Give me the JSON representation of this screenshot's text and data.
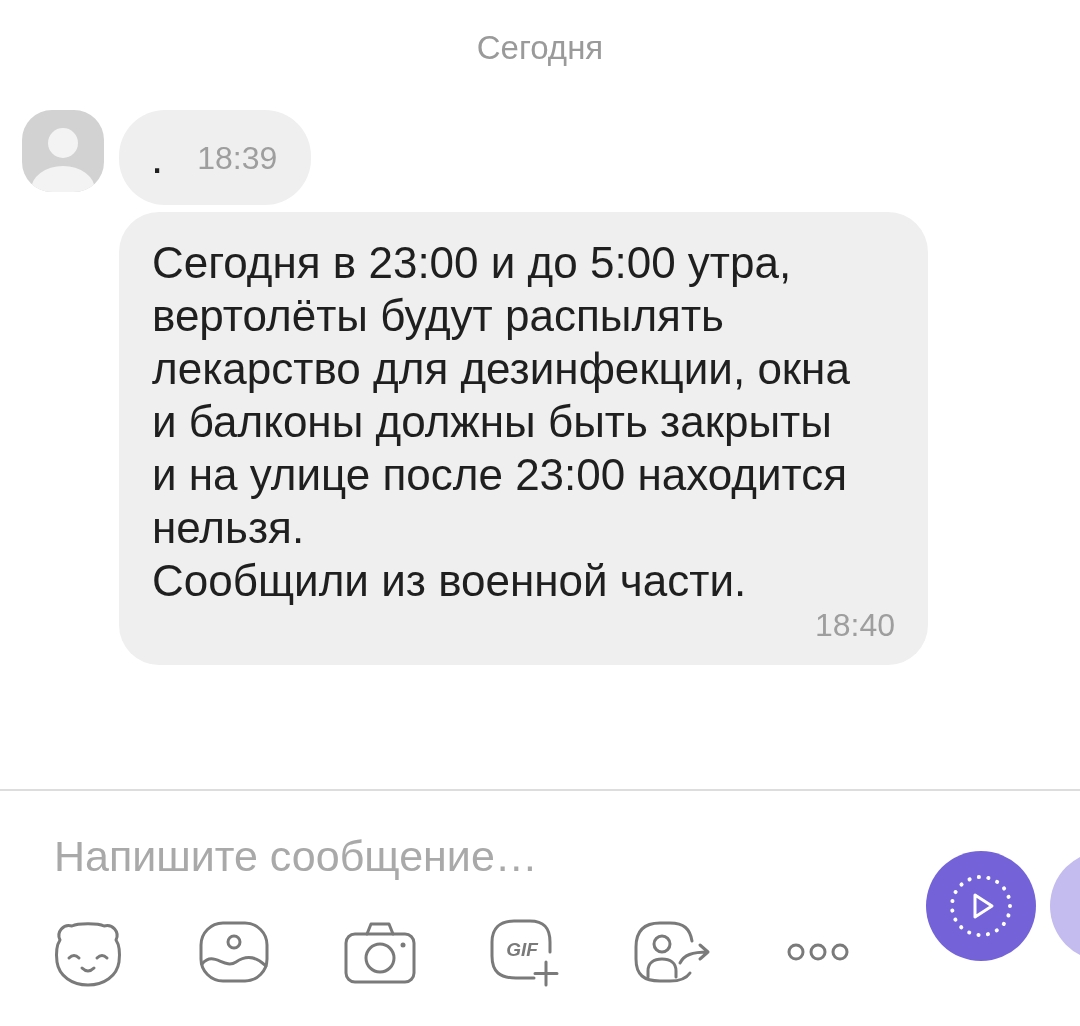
{
  "date_header": "Сегодня",
  "messages": [
    {
      "kind": "first",
      "text": ".",
      "time": "18:39"
    },
    {
      "kind": "continued",
      "text": "Сегодня в 23:00 и до 5:00 утра, вертолёты будут распылять лекарство для дезинфекции, окна и балконы должны быть закрыты и на улице после 23:00 находится нельзя.\nСообщили из военной части.",
      "time": "18:40"
    }
  ],
  "composer": {
    "placeholder": "Напишите сообщение…",
    "gif_label": "GIF"
  }
}
